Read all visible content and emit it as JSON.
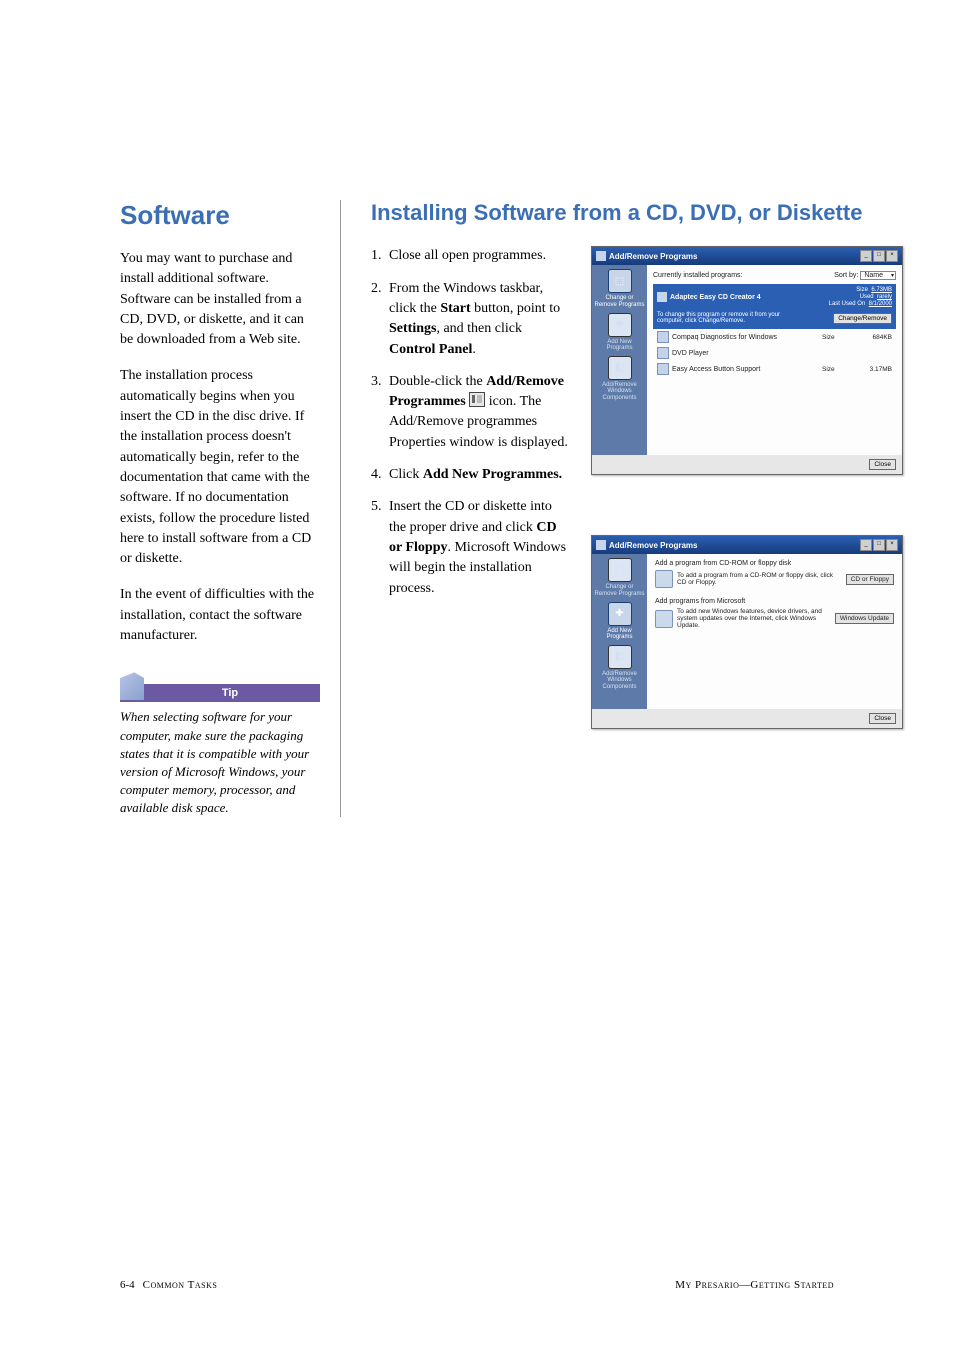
{
  "left": {
    "title": "Software",
    "p1": "You may want to purchase and install additional software. Software can be installed from a CD, DVD, or diskette, and it can be downloaded from a Web site.",
    "p2": "The installation process automatically begins when you insert the CD in the disc drive. If the installation process doesn't automatically begin, refer to the documentation that came with the software. If no documentation exists, follow the procedure listed here to install software from a CD or diskette.",
    "p3": "In the event of difficulties with the installation, contact the software manufacturer.",
    "tip_label": "Tip",
    "tip_body": "When selecting software for your computer, make sure the packaging states that it is compatible with your version of Microsoft Windows, your computer memory, processor, and available disk space."
  },
  "right": {
    "title": "Installing Software from a CD, DVD, or Diskette",
    "step1": {
      "num": "1.",
      "t1": "Close all open programmes."
    },
    "step2": {
      "num": "2.",
      "t1": "From the Windows taskbar, click the ",
      "b1": "Start",
      "t2": " button, point to ",
      "b2": "Settings",
      "t3": ", and then click ",
      "b3": "Control Panel",
      "t4": "."
    },
    "step3": {
      "num": "3.",
      "t1": "Double-click the ",
      "b1": "Add/Remove Programmes",
      "t2": " icon. The Add/Remove programmes Properties window is displayed."
    },
    "step4": {
      "num": "4.",
      "t1": "Click ",
      "b1": "Add New Programmes."
    },
    "step5": {
      "num": "5.",
      "t1": "Insert the CD or diskette into the proper drive and click ",
      "b1": "CD or Floppy",
      "t2": ". Microsoft Windows will begin the installation process."
    }
  },
  "fig1": {
    "title": "Add/Remove Programs",
    "hdr_left": "Currently installed programs:",
    "sort_lbl": "Sort by:",
    "sort_val": "Name",
    "sb": {
      "a_label": "Change or Remove Programs",
      "b_label": "Add New Programs",
      "c_label": "Add/Remove Windows Components"
    },
    "row_sel": {
      "name": "Adaptec Easy CD Creator 4",
      "size_l": "Size",
      "size_v": "6.73MB",
      "used_l": "Used",
      "used_v": "rarely",
      "last_l": "Last Used On",
      "last_v": "8/1/2000",
      "sub_txt": "To change this program or remove it from your computer, click Change/Remove.",
      "btn": "Change/Remove"
    },
    "row2": {
      "name": "Compaq Diagnostics for Windows",
      "size_l": "Size",
      "size_v": "684KB"
    },
    "row3": {
      "name": "DVD Player"
    },
    "row4": {
      "name": "Easy Access Button Support",
      "size_l": "Size",
      "size_v": "3.17MB"
    },
    "close": "Close"
  },
  "fig2": {
    "title": "Add/Remove Programs",
    "sec1": {
      "h": "Add a program from CD-ROM or floppy disk",
      "t": "To add a program from a CD-ROM or floppy disk, click CD or Floppy.",
      "btn": "CD or Floppy"
    },
    "sec2": {
      "h": "Add programs from Microsoft",
      "t": "To add new Windows features, device drivers, and system updates over the Internet, click Windows Update.",
      "btn": "Windows Update"
    },
    "sb": {
      "a_label": "Change or Remove Programs",
      "b_label": "Add New Programs",
      "c_label": "Add/Remove Windows Components"
    },
    "close": "Close"
  },
  "footer": {
    "page": "6-4",
    "section": "Common Tasks",
    "right1": "My Presario",
    "right_sep": "—",
    "right2": "Getting Started"
  }
}
